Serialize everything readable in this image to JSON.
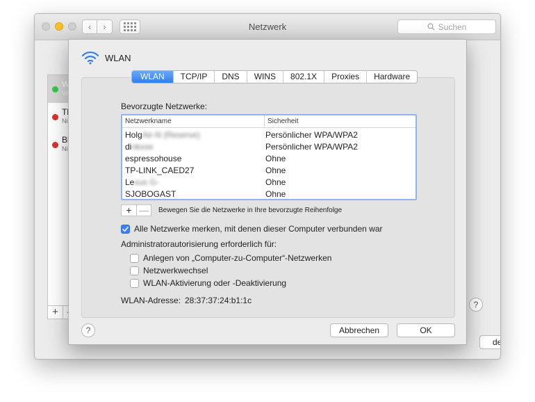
{
  "window": {
    "title": "Netzwerk",
    "search_placeholder": "Suchen",
    "back_icon": "‹",
    "forward_icon": "›",
    "sidebar": {
      "items": [
        {
          "name": "W",
          "sub": "Ve",
          "status_color": "#34c84a"
        },
        {
          "name": "Th",
          "sub": "Ni",
          "status_color": "#e0302a"
        },
        {
          "name": "Bl",
          "sub": "Ni",
          "status_color": "#e0302a"
        }
      ],
      "plus": "+",
      "minus": "–"
    },
    "help": "?",
    "partial_button": "den"
  },
  "sheet": {
    "service_name": "WLAN",
    "tabs": [
      {
        "label": "WLAN",
        "active": true
      },
      {
        "label": "TCP/IP"
      },
      {
        "label": "DNS"
      },
      {
        "label": "WINS"
      },
      {
        "label": "802.1X"
      },
      {
        "label": "Proxies"
      },
      {
        "label": "Hardware"
      }
    ],
    "preferred_label": "Bevorzugte Netzwerke:",
    "table": {
      "col_name": "Netzwerkname",
      "col_security": "Sicherheit",
      "rows": [
        {
          "name_visible": "Holg",
          "name_blur": "Air-N (Reserve)",
          "security": "Persönlicher WPA/WPA2"
        },
        {
          "name_visible": "di",
          "name_blur": "nkxxe",
          "security": "Persönlicher WPA/WPA2"
        },
        {
          "name_visible": "espressohouse",
          "name_blur": "",
          "security": "Ohne"
        },
        {
          "name_visible": "TP-LINK_CAED27",
          "name_blur": "",
          "security": "Ohne"
        },
        {
          "name_visible": "Le",
          "name_blur": "xus G-",
          "security": "Ohne"
        },
        {
          "name_visible": "SJOBOGAST",
          "name_blur": "",
          "security": "Ohne"
        }
      ]
    },
    "plus": "+",
    "minus": "—",
    "drag_hint": "Bewegen Sie die Netzwerke in Ihre bevorzugte Reihenfolge",
    "remember_label": "Alle Netzwerke merken, mit denen dieser Computer verbunden war",
    "remember_checked": true,
    "admin_label": "Administratorautorisierung erforderlich für:",
    "admin_options": [
      {
        "label": "Anlegen von „Computer-zu-Computer“-Netzwerken",
        "checked": false
      },
      {
        "label": "Netzwerkwechsel",
        "checked": false
      },
      {
        "label": "WLAN-Aktivierung oder -Deaktivierung",
        "checked": false
      }
    ],
    "address_label": "WLAN-Adresse:",
    "address_value": "28:37:37:24:b1:1c",
    "help": "?",
    "cancel": "Abbrechen",
    "ok": "OK"
  },
  "colors": {
    "accent": "#3b82f0",
    "wifi_icon": "#2f7fe8",
    "status_connected": "#34c84a",
    "status_off": "#e0302a"
  }
}
